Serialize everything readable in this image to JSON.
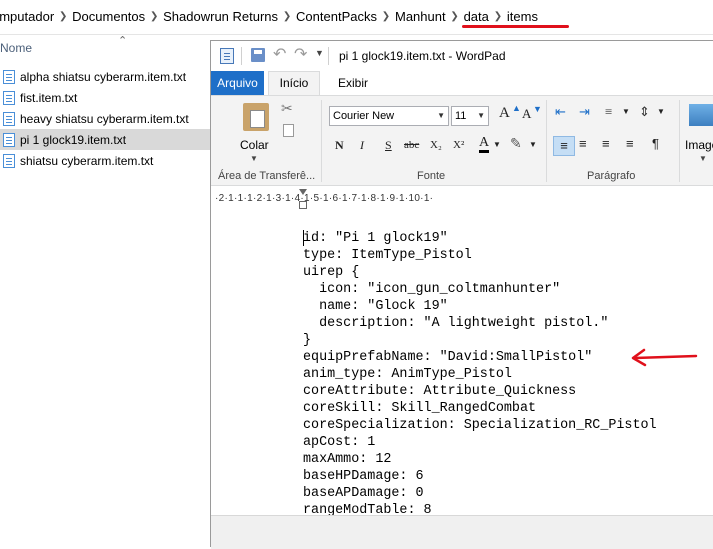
{
  "breadcrumb": [
    "omputador",
    "Documentos",
    "Shadowrun Returns",
    "ContentPacks",
    "Manhunt",
    "data",
    "items"
  ],
  "explorer": {
    "column_header": "Nome",
    "files": [
      {
        "name": "alpha shiatsu cyberarm.item.txt",
        "selected": false
      },
      {
        "name": "fist.item.txt",
        "selected": false
      },
      {
        "name": "heavy shiatsu cyberarm.item.txt",
        "selected": false
      },
      {
        "name": "pi 1 glock19.item.txt",
        "selected": true
      },
      {
        "name": "shiatsu cyberarm.item.txt",
        "selected": false
      }
    ]
  },
  "wordpad": {
    "title": "pi 1 glock19.item.txt - WordPad",
    "tabs": {
      "file": "Arquivo",
      "home": "Início",
      "view": "Exibir"
    },
    "ribbon": {
      "paste_label": "Colar",
      "clipboard_group": "Área de Transferê...",
      "font_group": "Fonte",
      "paragraph_group": "Parágrafo",
      "image_label": "Image",
      "font_name": "Courier New",
      "font_size": "11",
      "grow_font": "A",
      "shrink_font": "A",
      "bold": "N",
      "italic": "I",
      "underline": "S",
      "strike": "abc",
      "subscript": "X₂",
      "superscript": "X²",
      "font_color": "A"
    },
    "ruler": "·2·1·1·1·2·1·3·1·4·1·5·1·6·1·7·1·8·1·9·1·10·1·",
    "document_lines": [
      "id: \"Pi 1 glock19\"",
      "type: ItemType_Pistol",
      "uirep {",
      "  icon: \"icon_gun_coltmanhunter\"",
      "  name: \"Glock 19\"",
      "  description: \"A lightweight pistol.\"",
      "}",
      "equipPrefabName: \"David:SmallPistol\"",
      "anim_type: AnimType_Pistol",
      "coreAttribute: Attribute_Quickness",
      "coreSkill: Skill_RangedCombat",
      "coreSpecialization: Specialization_RC_Pistol",
      "apCost: 1",
      "maxAmmo: 12",
      "baseHPDamage: 6",
      "baseAPDamage: 0",
      "rangeModTable: 8"
    ]
  },
  "colors": {
    "accent_blue": "#1e6fc8",
    "annotation_red": "#e0101b",
    "selected_row": "#d9d9d9"
  }
}
